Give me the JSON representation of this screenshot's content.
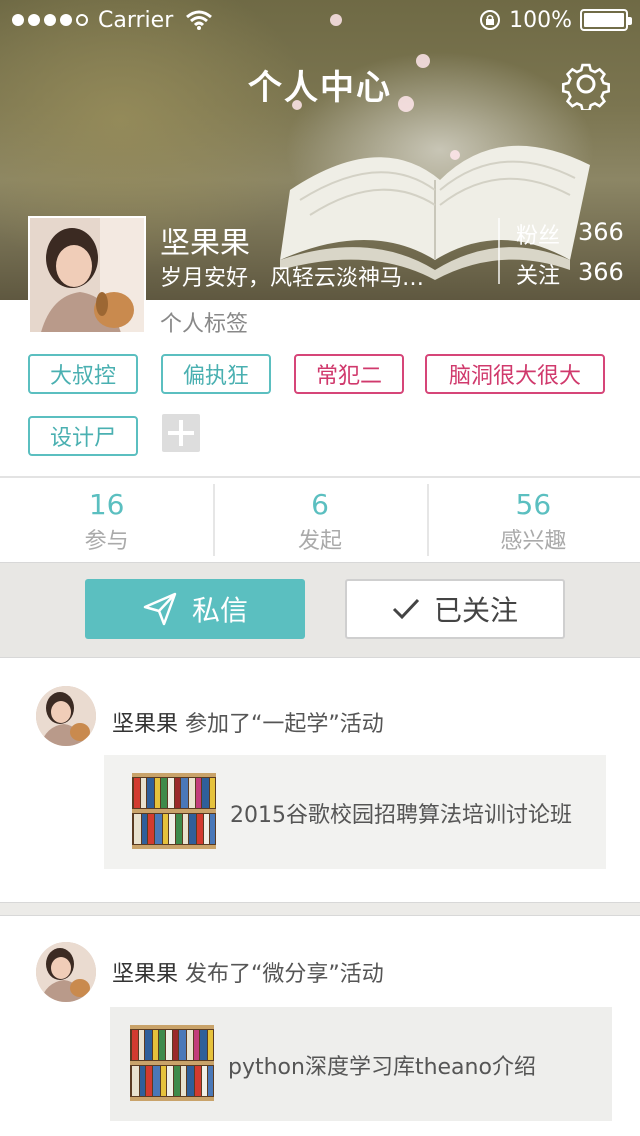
{
  "status_bar": {
    "carrier": "Carrier",
    "battery": "100%"
  },
  "header": {
    "title": "个人中心"
  },
  "profile": {
    "name": "坚果果",
    "motto": "岁月安好，风轻云淡神马…",
    "fans_label": "粉丝",
    "fans_count": "366",
    "follow_label": "关注",
    "follow_count": "366",
    "tags_label": "个人标签"
  },
  "tags": [
    {
      "label": "大叔控",
      "color": "#5bbfc0"
    },
    {
      "label": "偏执狂",
      "color": "#5bbfc0"
    },
    {
      "label": "常犯二",
      "color": "#d64578"
    },
    {
      "label": "脑洞很大很大",
      "color": "#d64578"
    },
    {
      "label": "设计尸",
      "color": "#5bbfc0"
    }
  ],
  "counts": [
    {
      "num": "16",
      "label": "参与"
    },
    {
      "num": "6",
      "label": "发起"
    },
    {
      "num": "56",
      "label": "感兴趣"
    }
  ],
  "actions": {
    "message": "私信",
    "follow": "已关注"
  },
  "feed": [
    {
      "user": "坚果果",
      "verb": "参加了“一起学”活动",
      "title": "2015谷歌校园招聘算法培训讨论班"
    },
    {
      "user": "坚果果",
      "verb": "发布了“微分享”活动",
      "title": "python深度学习库theano介绍"
    }
  ]
}
